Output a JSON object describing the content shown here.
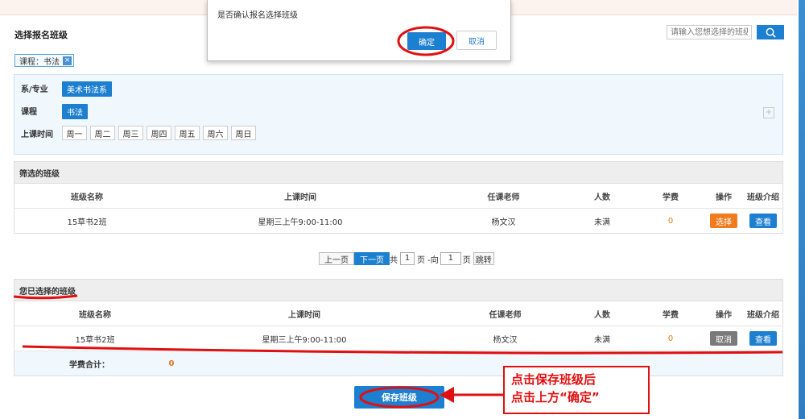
{
  "section_title": "选择报名班级",
  "search": {
    "placeholder": "请输入您想选择的班级",
    "icon": "search-icon"
  },
  "active_tag": {
    "label": "课程：书法",
    "close": "×"
  },
  "filters": {
    "dept_label": "系/专业",
    "dept_value": "美术书法系",
    "course_label": "课程",
    "course_value": "书法",
    "time_label": "上课时间",
    "days": [
      "周一",
      "周二",
      "周三",
      "周四",
      "周五",
      "周六",
      "周日"
    ],
    "expand": "+"
  },
  "filtered_panel": {
    "title": "筛选的班级",
    "columns": [
      "班级名称",
      "上课时间",
      "任课老师",
      "人数",
      "学费",
      "操作",
      "班级介绍"
    ],
    "rows": [
      {
        "name": "15草书2班",
        "time": "星期三上午9:00-11:00",
        "teacher": "杨文汉",
        "count": "未满",
        "fee": "0",
        "action": "选择",
        "intro": "查看"
      }
    ]
  },
  "pager": {
    "prev": "上一页",
    "next": "下一页",
    "total_prefix": "共",
    "total": "1",
    "total_suffix": "页 -向",
    "goto": "1",
    "goto_suffix": "页",
    "jump": "跳转"
  },
  "selected_panel": {
    "title": "您已选择的班级",
    "columns": [
      "班级名称",
      "上课时间",
      "任课老师",
      "人数",
      "学费",
      "操作",
      "班级介绍"
    ],
    "rows": [
      {
        "name": "15草书2班",
        "time": "星期三上午9:00-11:00",
        "teacher": "杨文汉",
        "count": "未满",
        "fee": "0",
        "action": "取消",
        "intro": "查看"
      }
    ],
    "total_label": "学费合计：",
    "total_value": "0"
  },
  "save_button": "保存班级",
  "dialog": {
    "message": "是否确认报名选择班级",
    "ok": "确定",
    "cancel": "取消"
  },
  "annotation": {
    "line1": "点击保存班级后",
    "line2": "点击上方“确定”"
  },
  "colors": {
    "primary": "#1d7fcf",
    "orange": "#f07c1e",
    "annotation": "#e01010",
    "fee": "#e8731f"
  }
}
